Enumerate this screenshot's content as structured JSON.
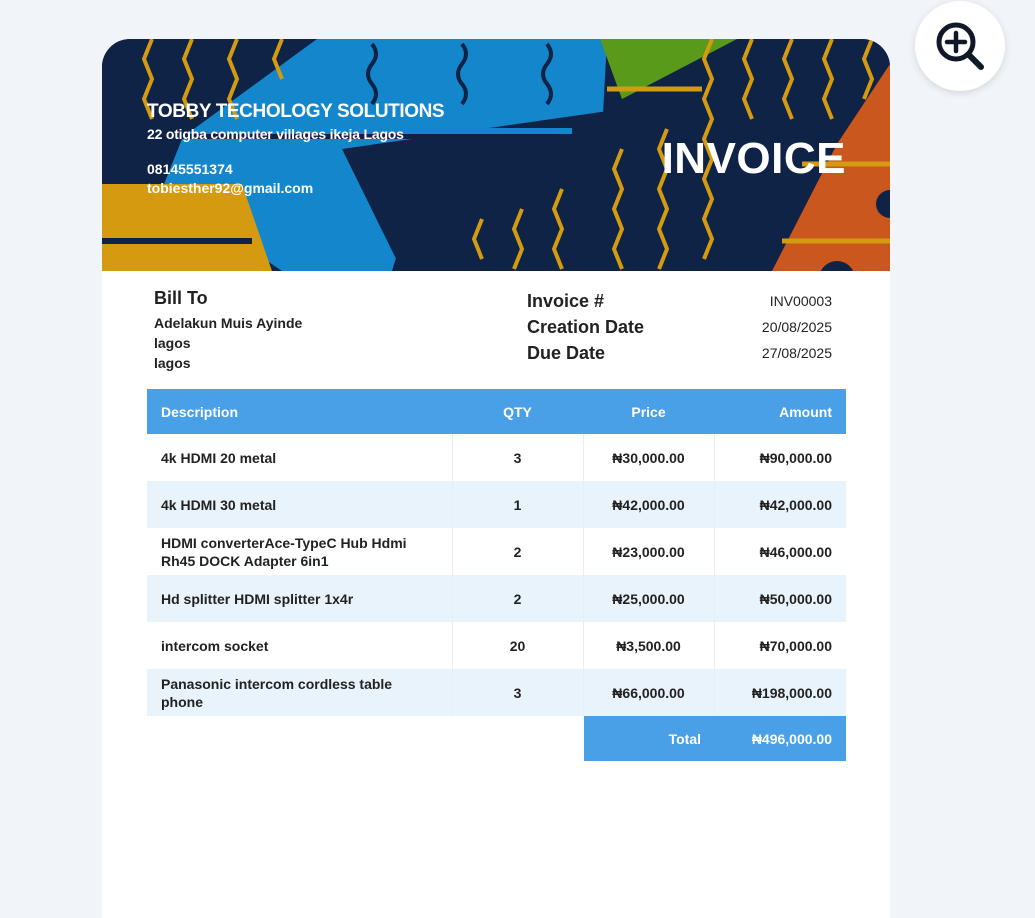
{
  "company": {
    "name": "TOBBY TECHOLOGY SOLUTIONS",
    "address": "22 otigba computer villages ikeja Lagos",
    "phone": "08145551374",
    "email": "tobiesther92@gmail.com"
  },
  "document_title": "INVOICE",
  "bill_to": {
    "heading": "Bill To",
    "name": "Adelakun Muis Ayinde",
    "line1": "lagos",
    "line2": "lagos"
  },
  "meta": [
    {
      "label": "Invoice #",
      "value": "INV00003"
    },
    {
      "label": "Creation Date",
      "value": "20/08/2025"
    },
    {
      "label": "Due Date",
      "value": "27/08/2025"
    }
  ],
  "table": {
    "headers": {
      "description": "Description",
      "qty": "QTY",
      "price": "Price",
      "amount": "Amount"
    },
    "rows": [
      {
        "description": "4k HDMI  20 metal",
        "qty": "3",
        "price": "₦30,000.00",
        "amount": "₦90,000.00"
      },
      {
        "description": "4k HDMI 30 metal",
        "qty": "1",
        "price": "₦42,000.00",
        "amount": "₦42,000.00"
      },
      {
        "description": "HDMI converterAce-TypeC Hub Hdmi Rh45 DOCK Adapter 6in1",
        "qty": "2",
        "price": "₦23,000.00",
        "amount": "₦46,000.00"
      },
      {
        "description": "Hd splitter HDMI splitter 1x4r",
        "qty": "2",
        "price": "₦25,000.00",
        "amount": "₦50,000.00"
      },
      {
        "description": "intercom socket",
        "qty": "20",
        "price": "₦3,500.00",
        "amount": "₦70,000.00"
      },
      {
        "description": "Panasonic intercom cordless table phone",
        "qty": "3",
        "price": "₦66,000.00",
        "amount": "₦198,000.00"
      }
    ]
  },
  "total": {
    "label": "Total",
    "value": "₦496,000.00"
  },
  "icons": {
    "zoom": "zoom-in-icon"
  },
  "colors": {
    "accent": "#4aa0e6",
    "banner_navy": "#0f2346",
    "stripe_alt": "#e8f3fc"
  }
}
